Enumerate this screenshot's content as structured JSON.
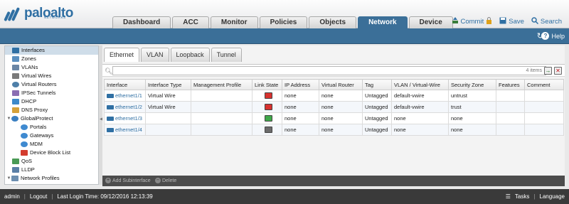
{
  "brand": {
    "name": "paloalto",
    "sub": "NETWORKS",
    "color": "#2f6fa3"
  },
  "main_tabs": [
    {
      "label": "Dashboard",
      "active": false
    },
    {
      "label": "ACC",
      "active": false
    },
    {
      "label": "Monitor",
      "active": false
    },
    {
      "label": "Policies",
      "active": false
    },
    {
      "label": "Objects",
      "active": false
    },
    {
      "label": "Network",
      "active": true
    },
    {
      "label": "Device",
      "active": false
    }
  ],
  "top_actions": {
    "commit": "Commit",
    "save": "Save",
    "search": "Search"
  },
  "help": "Help",
  "tree": [
    {
      "label": "Interfaces",
      "icon": "interfaces-icon",
      "indent": 0,
      "selected": true
    },
    {
      "label": "Zones",
      "icon": "zones-icon",
      "indent": 0
    },
    {
      "label": "VLANs",
      "icon": "vlans-icon",
      "indent": 0
    },
    {
      "label": "Virtual Wires",
      "icon": "virtual-wires-icon",
      "indent": 0
    },
    {
      "label": "Virtual Routers",
      "icon": "virtual-routers-icon",
      "indent": 0
    },
    {
      "label": "IPSec Tunnels",
      "icon": "ipsec-tunnels-icon",
      "indent": 0
    },
    {
      "label": "DHCP",
      "icon": "dhcp-icon",
      "indent": 0
    },
    {
      "label": "DNS Proxy",
      "icon": "dns-proxy-icon",
      "indent": 0
    },
    {
      "label": "GlobalProtect",
      "icon": "globalprotect-icon",
      "indent": 0,
      "expanded": true
    },
    {
      "label": "Portals",
      "icon": "portals-icon",
      "indent": 1
    },
    {
      "label": "Gateways",
      "icon": "gateways-icon",
      "indent": 1
    },
    {
      "label": "MDM",
      "icon": "mdm-icon",
      "indent": 1
    },
    {
      "label": "Device Block List",
      "icon": "device-block-list-icon",
      "indent": 1
    },
    {
      "label": "QoS",
      "icon": "qos-icon",
      "indent": 0
    },
    {
      "label": "LLDP",
      "icon": "lldp-icon",
      "indent": 0
    },
    {
      "label": "Network Profiles",
      "icon": "network-profiles-icon",
      "indent": 0,
      "expanded": true
    }
  ],
  "sub_tabs": [
    {
      "label": "Ethernet",
      "active": true
    },
    {
      "label": "VLAN",
      "active": false
    },
    {
      "label": "Loopback",
      "active": false
    },
    {
      "label": "Tunnel",
      "active": false
    }
  ],
  "filter": {
    "placeholder": "",
    "count": "4 items"
  },
  "table": {
    "columns": [
      "Interface",
      "Interface Type",
      "Management Profile",
      "Link State",
      "IP Address",
      "Virtual Router",
      "Tag",
      "VLAN / Virtual-Wire",
      "Security Zone",
      "Features",
      "Comment"
    ],
    "rows": [
      {
        "interface": "ethernet1/1",
        "type": "Virtual Wire",
        "mgmt": "",
        "link": "down",
        "ip": "none",
        "vr": "none",
        "tag": "Untagged",
        "vlan": "default-vwire",
        "zone": "untrust",
        "features": "",
        "comment": ""
      },
      {
        "interface": "ethernet1/2",
        "type": "Virtual Wire",
        "mgmt": "",
        "link": "down",
        "ip": "none",
        "vr": "none",
        "tag": "Untagged",
        "vlan": "default-vwire",
        "zone": "trust",
        "features": "",
        "comment": ""
      },
      {
        "interface": "ethernet1/3",
        "type": "",
        "mgmt": "",
        "link": "up",
        "ip": "none",
        "vr": "none",
        "tag": "Untagged",
        "vlan": "none",
        "zone": "none",
        "features": "",
        "comment": ""
      },
      {
        "interface": "ethernet1/4",
        "type": "",
        "mgmt": "",
        "link": "unknown",
        "ip": "none",
        "vr": "none",
        "tag": "Untagged",
        "vlan": "none",
        "zone": "none",
        "features": "",
        "comment": ""
      }
    ]
  },
  "link_colors": {
    "down": "#d8322f",
    "up": "#3fa84a",
    "unknown": "#6b6b6b"
  },
  "actions": {
    "add_subinterface": "Add Subinterface",
    "delete": "Delete"
  },
  "footer": {
    "user": "admin",
    "logout": "Logout",
    "last_login": "Last Login Time: 09/12/2016 12:13:39",
    "tasks": "Tasks",
    "language": "Language"
  }
}
